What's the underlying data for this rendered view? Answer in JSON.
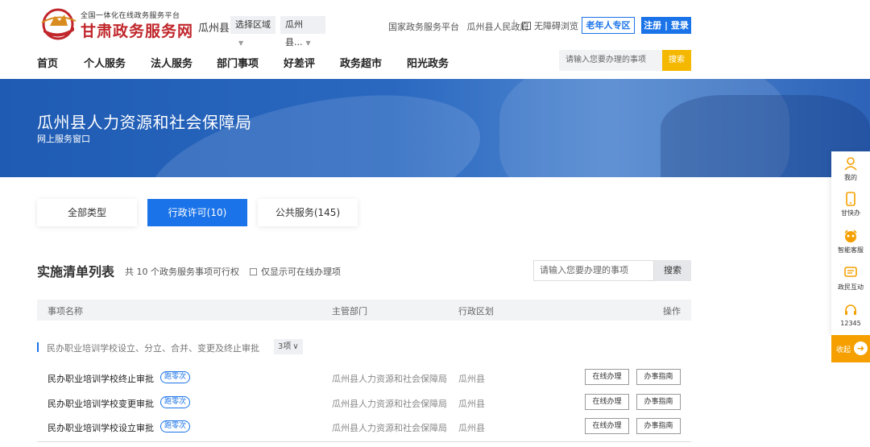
{
  "header": {
    "logo_small": "全国一体化在线政务服务平台",
    "logo_big": "甘肃政务服务网",
    "region_name": "瓜州县",
    "region_select_label": "选择区域",
    "region_select_value": "瓜州县...",
    "platform_link": "国家政务服务平台",
    "gov_link": "瓜州县人民政府",
    "separator": "|",
    "accessibility_label": "无障碍浏览",
    "elder_button": "老年人专区",
    "login_button": "注册 | 登录"
  },
  "nav": {
    "items": [
      "首页",
      "个人服务",
      "法人服务",
      "部门事项",
      "好差评",
      "政务超市",
      "阳光政务"
    ],
    "search_placeholder": "请输入您要办理的事项",
    "search_button": "搜索"
  },
  "banner": {
    "title": "瓜州县人力资源和社会保障局",
    "subtitle": "网上服务窗口"
  },
  "tabs": [
    {
      "label": "全部类型",
      "active": false
    },
    {
      "label": "行政许可(10)",
      "active": true
    },
    {
      "label": "公共服务(145)",
      "active": false
    }
  ],
  "list": {
    "title": "实施清单列表",
    "count_text": "共 10 个政务服务事项可行权",
    "online_only_label": "仅显示可在线办理项",
    "search_placeholder": "请输入您要办理的事项",
    "search_button": "搜索",
    "columns": [
      "事项名称",
      "主管部门",
      "行政区划",
      "操作"
    ],
    "group": {
      "title": "民办职业培训学校设立、分立、合并、变更及终止审批",
      "badge": "3项"
    },
    "rows": [
      {
        "name": "民办职业培训学校终止审批",
        "tag": "跑零次",
        "dept": "瓜州县人力资源和社会保障局",
        "area": "瓜州县",
        "btn_online": "在线办理",
        "btn_guide": "办事指南"
      },
      {
        "name": "民办职业培训学校变更审批",
        "tag": "跑零次",
        "dept": "瓜州县人力资源和社会保障局",
        "area": "瓜州县",
        "btn_online": "在线办理",
        "btn_guide": "办事指南"
      },
      {
        "name": "民办职业培训学校设立审批",
        "tag": "跑零次",
        "dept": "瓜州县人力资源和社会保障局",
        "area": "瓜州县",
        "btn_online": "在线办理",
        "btn_guide": "办事指南"
      }
    ]
  },
  "float_panel": {
    "items": [
      {
        "label": "我的",
        "icon": "user-icon"
      },
      {
        "label": "甘快办",
        "icon": "phone-icon"
      },
      {
        "label": "智能客服",
        "icon": "robot-icon"
      },
      {
        "label": "政民互动",
        "icon": "chat-icon"
      },
      {
        "label": "12345",
        "icon": "headset-icon"
      }
    ],
    "collapse_label": "收起",
    "collapse_icon": "arrow-right-icon"
  },
  "colors": {
    "primary": "#1a73e8",
    "accent": "#f5b800",
    "brand_red": "#c0262b",
    "banner_blue": "#1f5bb3"
  }
}
